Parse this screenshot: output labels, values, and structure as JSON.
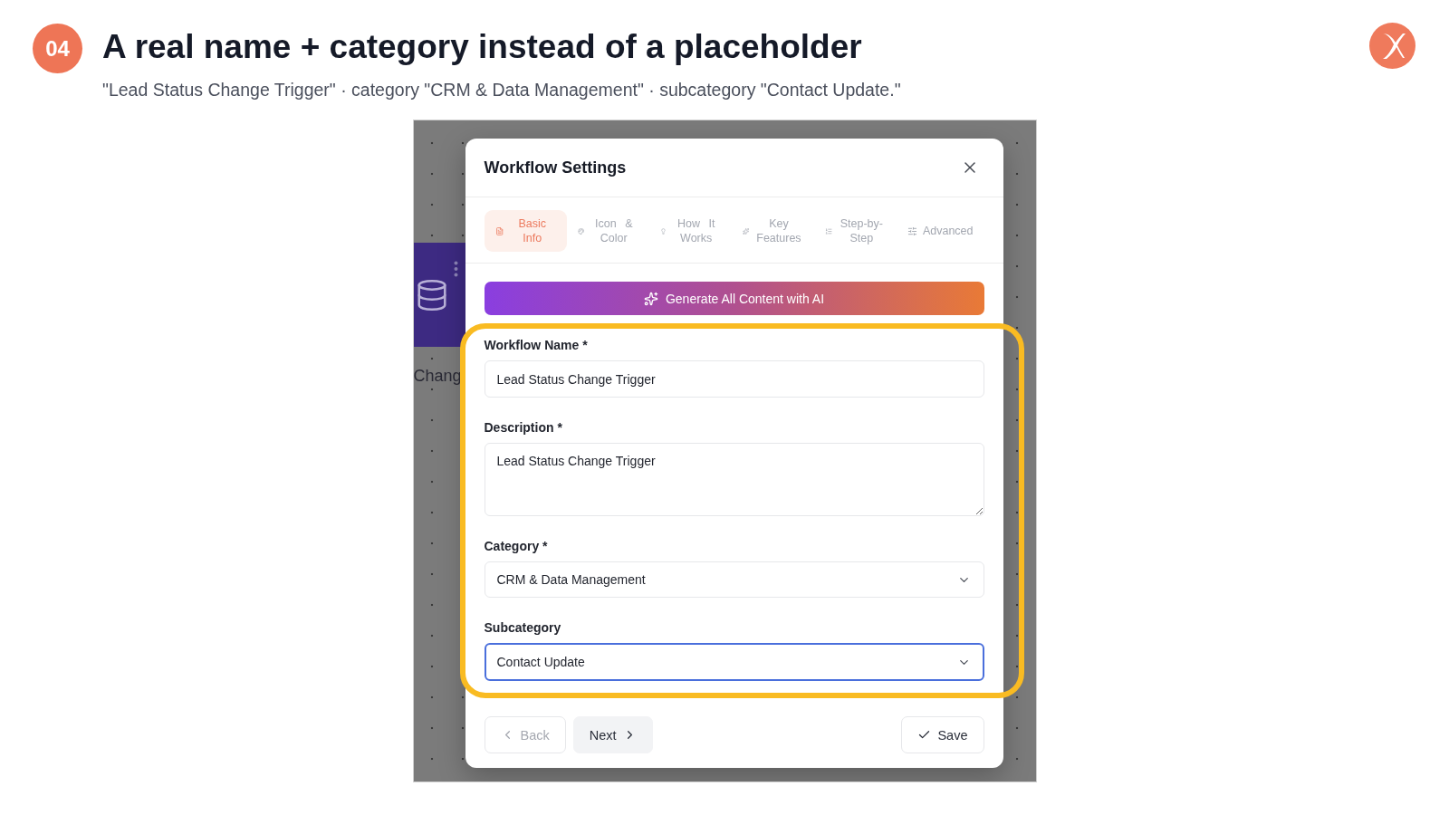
{
  "slide": {
    "number": "04",
    "title": "A real name + category instead of a placeholder",
    "subtitle": "\"Lead Status Change Trigger\" · category \"CRM & Data Management\" · subcategory \"Contact Update.\""
  },
  "canvas": {
    "node_label": "Chang"
  },
  "dialog": {
    "title": "Workflow Settings",
    "tabs": [
      {
        "label": "Basic Info",
        "selected": true
      },
      {
        "label": "Icon & Color",
        "selected": false
      },
      {
        "label": "How It Works",
        "selected": false
      },
      {
        "label": "Key Features",
        "selected": false
      },
      {
        "label": "Step-by-Step",
        "selected": false
      },
      {
        "label": "Advanced",
        "selected": false
      }
    ],
    "generate_button": "Generate All Content with AI",
    "fields": [
      {
        "kind": "text",
        "label": "Workflow Name *",
        "value": "Lead Status Change Trigger",
        "focused": false
      },
      {
        "kind": "textarea",
        "label": "Description *",
        "value": "Lead Status Change Trigger",
        "focused": false
      },
      {
        "kind": "select",
        "label": "Category *",
        "value": "CRM & Data Management",
        "focused": false
      },
      {
        "kind": "select",
        "label": "Subcategory",
        "value": "Contact Update",
        "focused": true
      }
    ],
    "buttons": [
      {
        "kind": "back",
        "label": "Back",
        "disabled": true
      },
      {
        "kind": "next",
        "label": "Next",
        "disabled": false
      },
      {
        "kind": "save",
        "label": "Save",
        "disabled": false
      }
    ]
  }
}
